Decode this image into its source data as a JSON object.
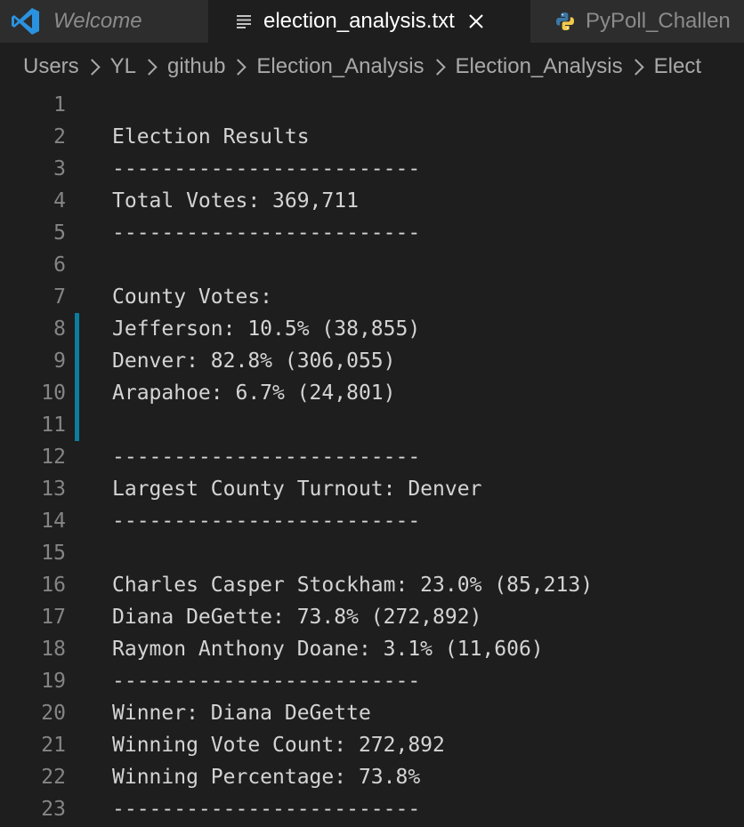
{
  "tabs": [
    {
      "label": "Welcome",
      "icon": "vscode-logo-icon",
      "active": false
    },
    {
      "label": "election_analysis.txt",
      "icon": "text-file-icon",
      "active": true
    },
    {
      "label": "PyPoll_Challen",
      "icon": "python-icon",
      "active": false
    }
  ],
  "breadcrumb": [
    "Users",
    "YL",
    "github",
    "Election_Analysis",
    "Election_Analysis",
    "Elect"
  ],
  "lines": [
    {
      "n": "1",
      "text": ""
    },
    {
      "n": "2",
      "text": "Election Results"
    },
    {
      "n": "3",
      "text": "-------------------------"
    },
    {
      "n": "4",
      "text": "Total Votes: 369,711"
    },
    {
      "n": "5",
      "text": "-------------------------"
    },
    {
      "n": "6",
      "text": ""
    },
    {
      "n": "7",
      "text": "County Votes:"
    },
    {
      "n": "8",
      "text": "Jefferson: 10.5% (38,855)"
    },
    {
      "n": "9",
      "text": "Denver: 82.8% (306,055)"
    },
    {
      "n": "10",
      "text": "Arapahoe: 6.7% (24,801)"
    },
    {
      "n": "11",
      "text": ""
    },
    {
      "n": "12",
      "text": "-------------------------"
    },
    {
      "n": "13",
      "text": "Largest County Turnout: Denver"
    },
    {
      "n": "14",
      "text": "-------------------------"
    },
    {
      "n": "15",
      "text": ""
    },
    {
      "n": "16",
      "text": "Charles Casper Stockham: 23.0% (85,213)"
    },
    {
      "n": "17",
      "text": "Diana DeGette: 73.8% (272,892)"
    },
    {
      "n": "18",
      "text": "Raymon Anthony Doane: 3.1% (11,606)"
    },
    {
      "n": "19",
      "text": "-------------------------"
    },
    {
      "n": "20",
      "text": "Winner: Diana DeGette"
    },
    {
      "n": "21",
      "text": "Winning Vote Count: 272,892"
    },
    {
      "n": "22",
      "text": "Winning Percentage: 73.8%"
    },
    {
      "n": "23",
      "text": "-------------------------"
    }
  ],
  "colors": {
    "accent_gutter": "#0c7d9d",
    "vscode_blue": "#2a93e0",
    "python_blue": "#3b78a8",
    "python_yellow": "#f2c94c"
  }
}
